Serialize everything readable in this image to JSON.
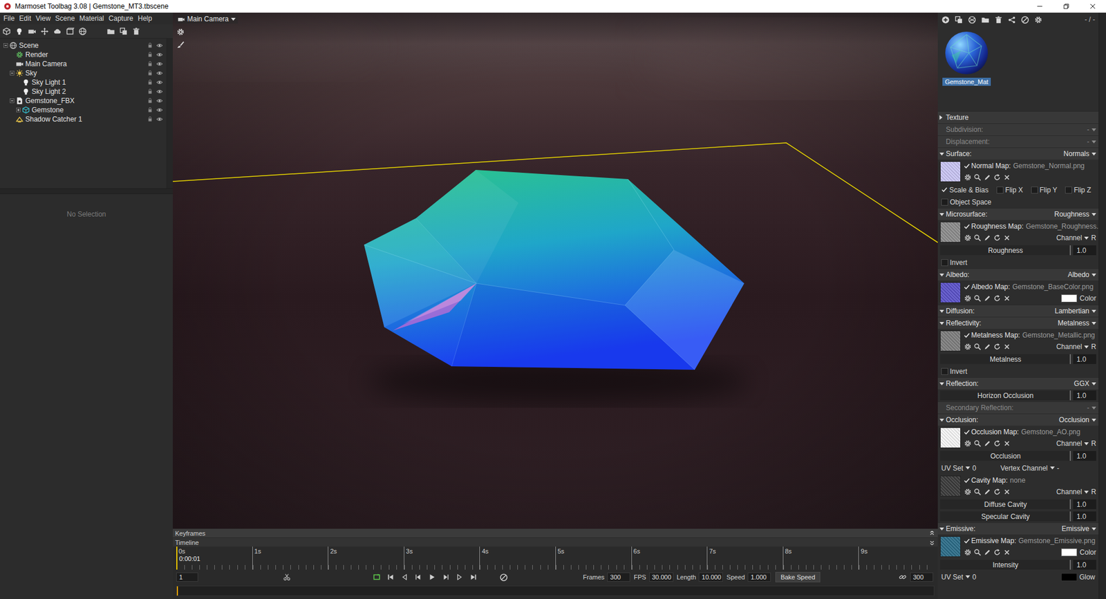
{
  "window": {
    "title": "Marmoset Toolbag 3.08 | Gemstone_MT3.tbscene"
  },
  "menu": [
    "File",
    "Edit",
    "View",
    "Scene",
    "Material",
    "Capture",
    "Help"
  ],
  "viewport": {
    "camera": "Main Camera"
  },
  "scene_tree": [
    {
      "label": "Scene",
      "depth": 0,
      "kind": "scene",
      "expanded": true
    },
    {
      "label": "Render",
      "depth": 1,
      "kind": "render"
    },
    {
      "label": "Main Camera",
      "depth": 1,
      "kind": "camera"
    },
    {
      "label": "Sky",
      "depth": 1,
      "kind": "sky",
      "expanded": true
    },
    {
      "label": "Sky Light 1",
      "depth": 2,
      "kind": "light"
    },
    {
      "label": "Sky Light 2",
      "depth": 2,
      "kind": "light"
    },
    {
      "label": "Gemstone_FBX",
      "depth": 1,
      "kind": "model",
      "expanded": true
    },
    {
      "label": "Gemstone",
      "depth": 2,
      "kind": "mesh",
      "expanded": false
    },
    {
      "label": "Shadow Catcher 1",
      "depth": 1,
      "kind": "shadow"
    }
  ],
  "inspector": {
    "empty_text": "No Selection"
  },
  "material_toolbar": {
    "page_label": "- / -"
  },
  "materials": [
    {
      "name": "Gemstone_Mat",
      "selected": true
    }
  ],
  "material_panel": [
    {
      "kind": "section",
      "title": "Texture",
      "value": "",
      "expanded": false,
      "disabled": false
    },
    {
      "kind": "section",
      "title": "Subdivision:",
      "value": "-",
      "disabled": true
    },
    {
      "kind": "section",
      "title": "Displacement:",
      "value": "-",
      "disabled": true
    },
    {
      "kind": "section",
      "title": "Surface:",
      "value": "Normals",
      "expanded": true,
      "disabled": false
    },
    {
      "kind": "map",
      "label": "Normal Map:",
      "file": "Gemstone_Normal.png",
      "checked": true,
      "color": "#c9c5f4",
      "extra": null
    },
    {
      "kind": "checks",
      "items": [
        {
          "label": "Scale & Bias",
          "checked": true
        },
        {
          "label": "Flip X",
          "checked": false
        },
        {
          "label": "Flip Y",
          "checked": false
        },
        {
          "label": "Flip Z",
          "checked": false
        }
      ]
    },
    {
      "kind": "checks",
      "items": [
        {
          "label": "Object Space",
          "checked": false
        }
      ]
    },
    {
      "kind": "section",
      "title": "Microsurface:",
      "value": "Roughness",
      "expanded": true,
      "disabled": false
    },
    {
      "kind": "map",
      "label": "Roughness Map:",
      "file": "Gemstone_Roughness.",
      "checked": true,
      "color": "#8c8c8c",
      "extra": {
        "kind": "channel",
        "label": "Channel",
        "value": "R"
      }
    },
    {
      "kind": "slider",
      "label": "Roughness",
      "value": "1.0",
      "level": 1.0
    },
    {
      "kind": "checks",
      "items": [
        {
          "label": "Invert",
          "checked": false
        }
      ]
    },
    {
      "kind": "section",
      "title": "Albedo:",
      "value": "Albedo",
      "expanded": true,
      "disabled": false
    },
    {
      "kind": "map",
      "label": "Albedo Map:",
      "file": "Gemstone_BaseColor.png",
      "checked": true,
      "color": "#5b52c9",
      "extra": {
        "kind": "color",
        "label": "Color",
        "color": "#ffffff"
      }
    },
    {
      "kind": "section",
      "title": "Diffusion:",
      "value": "Lambertian",
      "expanded": true,
      "disabled": false
    },
    {
      "kind": "section",
      "title": "Reflectivity:",
      "value": "Metalness",
      "expanded": true,
      "disabled": false
    },
    {
      "kind": "map",
      "label": "Metalness Map:",
      "file": "Gemstone_Metallic.png",
      "checked": true,
      "color": "#7e7e7e",
      "extra": {
        "kind": "channel",
        "label": "Channel",
        "value": "R"
      }
    },
    {
      "kind": "slider",
      "label": "Metalness",
      "value": "1.0",
      "level": 1.0
    },
    {
      "kind": "checks",
      "items": [
        {
          "label": "Invert",
          "checked": false
        }
      ]
    },
    {
      "kind": "section",
      "title": "Reflection:",
      "value": "GGX",
      "expanded": true,
      "disabled": false
    },
    {
      "kind": "slider",
      "label": "Horizon Occlusion",
      "value": "1.0",
      "level": 1.0
    },
    {
      "kind": "section",
      "title": "Secondary Reflection:",
      "value": "-",
      "disabled": true
    },
    {
      "kind": "section",
      "title": "Occlusion:",
      "value": "Occlusion",
      "expanded": true,
      "disabled": false
    },
    {
      "kind": "map",
      "label": "Occlusion Map:",
      "file": "Gemstone_AO.png",
      "checked": true,
      "color": "#f6f6f6",
      "extra": {
        "kind": "channel",
        "label": "Channel",
        "value": "R"
      }
    },
    {
      "kind": "slider",
      "label": "Occlusion",
      "value": "1.0",
      "level": 1.0
    },
    {
      "kind": "uvset",
      "label": "UV Set",
      "value": "0",
      "vertex_label": "Vertex Channel",
      "vertex_value": "-"
    },
    {
      "kind": "map",
      "label": "Cavity Map:",
      "file": "none",
      "checked": true,
      "color": "#3a3a3a",
      "extra": {
        "kind": "channel",
        "label": "Channel",
        "value": "R"
      }
    },
    {
      "kind": "slider",
      "label": "Diffuse Cavity",
      "value": "1.0",
      "level": 1.0
    },
    {
      "kind": "slider",
      "label": "Specular Cavity",
      "value": "1.0",
      "level": 1.0
    },
    {
      "kind": "section",
      "title": "Emissive:",
      "value": "Emissive",
      "expanded": true,
      "disabled": false
    },
    {
      "kind": "map",
      "label": "Emissive Map:",
      "file": "Gemstone_Emissive.png",
      "checked": true,
      "color": "#2b6c88",
      "extra": {
        "kind": "color",
        "label": "Color",
        "color": "#ffffff"
      }
    },
    {
      "kind": "slider",
      "label": "Intensity",
      "value": "1.0",
      "level": 1.0
    },
    {
      "kind": "glow",
      "label": "UV Set",
      "value": "0",
      "glow_label": "Glow",
      "color": "#000000"
    }
  ],
  "timeline": {
    "keyframes_label": "Keyframes",
    "timeline_label": "Timeline",
    "ticks": [
      "0s",
      "1s",
      "2s",
      "3s",
      "4s",
      "5s",
      "6s",
      "7s",
      "8s",
      "9s"
    ],
    "current_time": "0:00:01",
    "playhead": 0.0
  },
  "playback": {
    "frame": "1",
    "frames_label": "Frames",
    "frames": "300",
    "fps_label": "FPS",
    "fps": "30.000",
    "length_label": "Length",
    "length": "10.000",
    "speed_label": "Speed",
    "speed": "1.000",
    "bake_speed": "Bake Speed",
    "end_frame": "300",
    "scrub": 0.0
  }
}
